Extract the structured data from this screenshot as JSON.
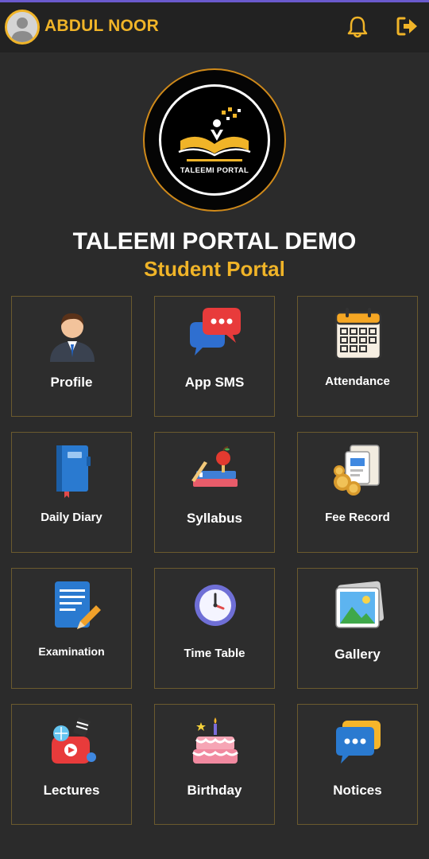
{
  "header": {
    "user_name": "ABDUL NOOR",
    "avatar_icon": "user-avatar-icon",
    "notification_icon": "bell-icon",
    "logout_icon": "logout-icon",
    "accent_color": "#f0b428"
  },
  "brand": {
    "logo_text": "TALEEMI PORTAL",
    "title": "TALEEMI PORTAL DEMO",
    "subtitle": "Student Portal"
  },
  "menu": [
    {
      "label": "Profile",
      "icon": "businessman-icon"
    },
    {
      "label": "App SMS",
      "icon": "chat-bubbles-icon"
    },
    {
      "label": "Attendance",
      "icon": "calendar-icon"
    },
    {
      "label": "Daily Diary",
      "icon": "diary-book-icon"
    },
    {
      "label": "Syllabus",
      "icon": "books-apple-icon"
    },
    {
      "label": "Fee Record",
      "icon": "fee-invoice-coins-icon"
    },
    {
      "label": "Examination",
      "icon": "exam-document-pencil-icon"
    },
    {
      "label": "Time Table",
      "icon": "clock-icon"
    },
    {
      "label": "Gallery",
      "icon": "photo-gallery-icon"
    },
    {
      "label": "Lectures",
      "icon": "lectures-media-icon"
    },
    {
      "label": "Birthday",
      "icon": "birthday-cake-icon"
    },
    {
      "label": "Notices",
      "icon": "notice-chat-icon"
    }
  ]
}
